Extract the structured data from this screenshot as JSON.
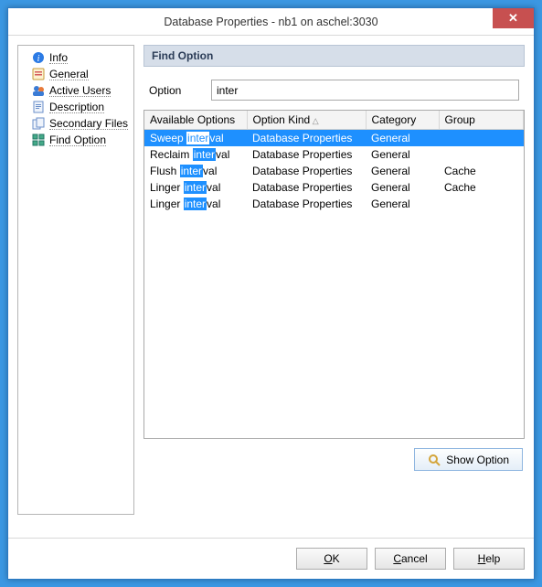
{
  "window": {
    "title": "Database Properties - nb1 on aschel:3030"
  },
  "sidebar": {
    "items": [
      {
        "label": "Info"
      },
      {
        "label": "General"
      },
      {
        "label": "Active Users"
      },
      {
        "label": "Description"
      },
      {
        "label": "Secondary Files"
      },
      {
        "label": "Find Option"
      }
    ]
  },
  "panel": {
    "header": "Find Option",
    "option_label": "Option",
    "option_value": "inter",
    "columns": {
      "c0": "Available Options",
      "c1": "Option Kind",
      "c2": "Category",
      "c3": "Group"
    },
    "rows": [
      {
        "pre": "Sweep ",
        "match": "inter",
        "post": "val",
        "kind": "Database Properties",
        "cat": "General",
        "grp": ""
      },
      {
        "pre": "Reclaim ",
        "match": "inter",
        "post": "val",
        "kind": "Database Properties",
        "cat": "General",
        "grp": ""
      },
      {
        "pre": "Flush ",
        "match": "inter",
        "post": "val",
        "kind": "Database Properties",
        "cat": "General",
        "grp": "Cache"
      },
      {
        "pre": "Linger ",
        "match": "inter",
        "post": "val",
        "kind": "Database Properties",
        "cat": "General",
        "grp": "Cache"
      },
      {
        "pre": "Linger ",
        "match": "inter",
        "post": "val",
        "kind": "Database Properties",
        "cat": "General",
        "grp": ""
      }
    ],
    "show_option_label": "Show Option"
  },
  "footer": {
    "ok_u": "O",
    "ok_rest": "K",
    "cancel_u": "C",
    "cancel_rest": "ancel",
    "help_u": "H",
    "help_rest": "elp"
  }
}
